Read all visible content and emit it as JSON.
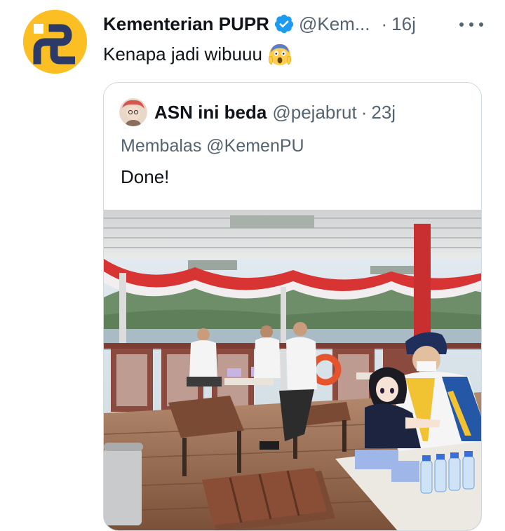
{
  "tweet": {
    "author_name": "Kementerian PUPR",
    "author_handle": "@Kem...",
    "separator": "·",
    "time": "16j",
    "text": "Kenapa jadi wibuuu",
    "emoji": "face-screaming-in-fear"
  },
  "quoted": {
    "author_name": "ASN ini beda",
    "author_handle": "@pejabrut",
    "separator": "·",
    "time": "23j",
    "replying_to": "Membalas @KemenPU",
    "text": "Done!"
  },
  "icons": {
    "verified": "verified-badge-icon",
    "more": "more-horizontal-icon"
  },
  "colors": {
    "text_primary": "#0f1419",
    "text_secondary": "#536471",
    "verified_blue": "#1d9bf0",
    "border": "#cfd9de",
    "pupr_yellow": "#fbbf24",
    "pupr_navy": "#2b3a67"
  }
}
